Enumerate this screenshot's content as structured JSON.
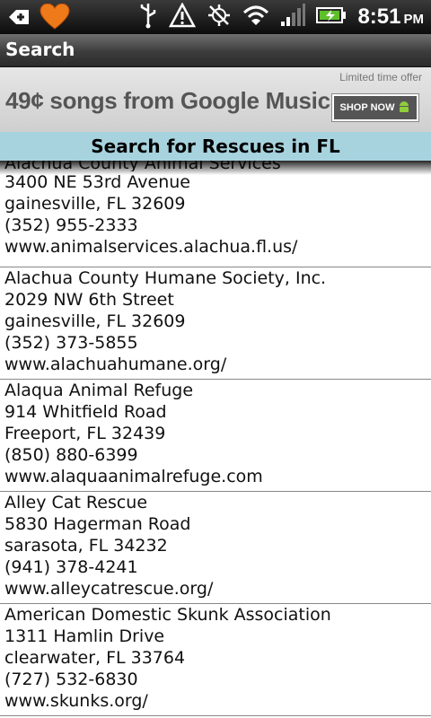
{
  "status_bar": {
    "time": "8:51",
    "ampm": "PM",
    "icons": [
      "notification-plus-icon",
      "heart-icon",
      "usb-icon",
      "warning-icon",
      "gps-off-icon",
      "wifi-icon",
      "signal-icon",
      "battery-icon"
    ]
  },
  "app": {
    "title": "Search"
  },
  "ad": {
    "offer": "Limited time offer",
    "headline": "49¢ songs from Google Music.",
    "button": "SHOP NOW"
  },
  "header": {
    "title": "Search for Rescues in FL"
  },
  "rescues": [
    {
      "name": "Alachua County Animal Services",
      "address": "3400 NE 53rd Avenue",
      "city": "gainesville, FL 32609",
      "phone": "(352) 955-2333",
      "url": "www.animalservices.alachua.fl.us/"
    },
    {
      "name": "Alachua County Humane Society, Inc.",
      "address": "2029 NW 6th Street",
      "city": "gainesville, FL 32609",
      "phone": "(352) 373-5855",
      "url": "www.alachuahumane.org/"
    },
    {
      "name": "Alaqua Animal Refuge",
      "address": "914 Whitfield Road",
      "city": "Freeport, FL 32439",
      "phone": "(850) 880-6399",
      "url": "www.alaquaanimalrefuge.com"
    },
    {
      "name": "Alley Cat Rescue",
      "address": "5830 Hagerman Road",
      "city": "sarasota, FL 34232",
      "phone": "(941) 378-4241",
      "url": "www.alleycatrescue.org/"
    },
    {
      "name": "American Domestic Skunk Association",
      "address": "1311 Hamlin Drive",
      "city": "clearwater, FL 33764",
      "phone": "(727) 532-6830",
      "url": "www.skunks.org/"
    }
  ]
}
